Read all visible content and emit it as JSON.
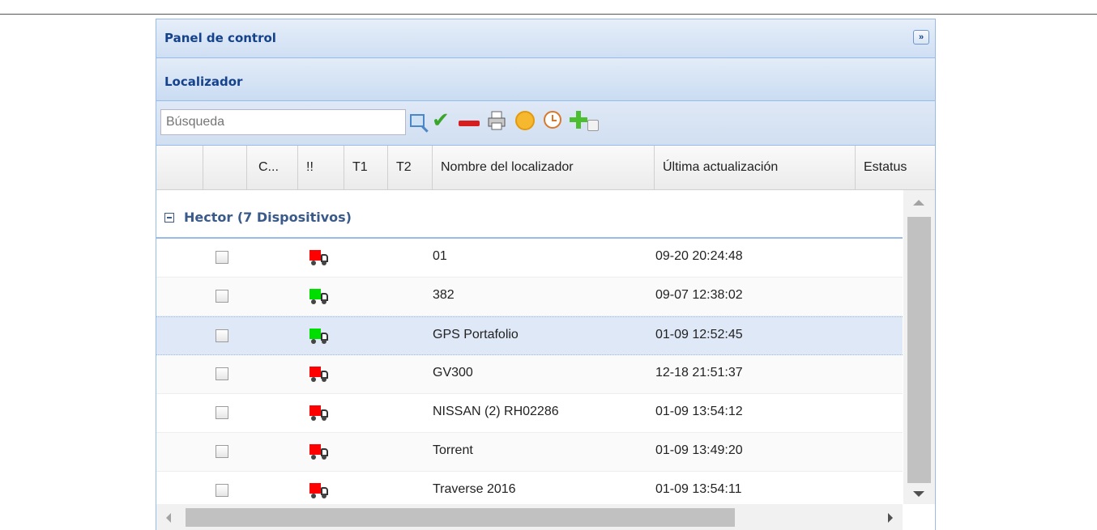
{
  "window": {
    "panel_title": "Panel de control",
    "section_title": "Localizador",
    "collapse_glyph": "»"
  },
  "toolbar": {
    "search_placeholder": "Búsqueda",
    "icons": [
      "search-icon",
      "check-icon",
      "remove-icon",
      "print-icon",
      "refresh-icon",
      "clock-icon",
      "add-icon",
      "checkbox-icon"
    ]
  },
  "columns": [
    "",
    "",
    "C...",
    "!!",
    "T1",
    "T2",
    "Nombre del localizador",
    "Última actualización",
    "Estatus"
  ],
  "group": {
    "label": "Hector (7 Dispositivos)"
  },
  "rows": [
    {
      "name": "01",
      "time": "09-20 20:24:48",
      "status_color": "#ff0000"
    },
    {
      "name": "382",
      "time": "09-07 12:38:02",
      "status_color": "#00dd00"
    },
    {
      "name": "GPS Portafolio",
      "time": "01-09 12:52:45",
      "status_color": "#00dd00"
    },
    {
      "name": "GV300",
      "time": "12-18 21:51:37",
      "status_color": "#ff0000"
    },
    {
      "name": "NISSAN (2) RH02286",
      "time": "01-09 13:54:12",
      "status_color": "#ff0000"
    },
    {
      "name": "Torrent",
      "time": "01-09 13:49:20",
      "status_color": "#ff0000"
    },
    {
      "name": "Traverse 2016",
      "time": "01-09 13:54:11",
      "status_color": "#ff0000"
    }
  ],
  "colors": {
    "header_text": "#15428b",
    "group_text": "#3a5a8a",
    "selected_row": "#dfe8f6",
    "offline": "#ff0000",
    "online": "#00dd00"
  }
}
